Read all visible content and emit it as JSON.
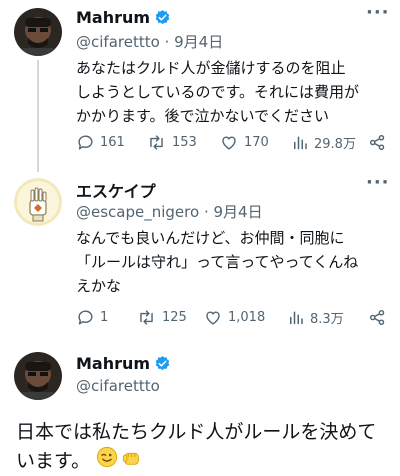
{
  "tweets": [
    {
      "name": "Mahrum",
      "handle": "@cifarettto",
      "date": "9月4日",
      "lines": [
        "あなたはクルド人が金儲けするのを阻止",
        "しようとしているのです。それには費用が",
        "かかります。後で泣かないでください"
      ],
      "replies": "161",
      "retweets": "153",
      "likes": "170",
      "views": "29.8万"
    },
    {
      "name": "エスケイプ",
      "handle": "@escape_nigero",
      "date": "9月4日",
      "lines": [
        "なんでも良いんだけど、お仲間・同胞に",
        "「ルールは守れ」って言ってやってくんね",
        "えかな"
      ],
      "replies": "1",
      "retweets": "125",
      "likes": "1,018",
      "views": "8.3万"
    }
  ],
  "main_tweet": {
    "name": "Mahrum",
    "handle": "@cifarettto",
    "lines": [
      "日本では私たちクルド人がルールを決めて",
      "います。"
    ]
  },
  "separator": "·",
  "icons": [
    "verified-badge-icon",
    "more-icon",
    "reply-icon",
    "retweet-icon",
    "like-icon",
    "views-icon",
    "share-icon"
  ],
  "colors": {
    "accent": "#1d9bf0",
    "secondary_text": "#536471",
    "text": "#0f1419"
  }
}
